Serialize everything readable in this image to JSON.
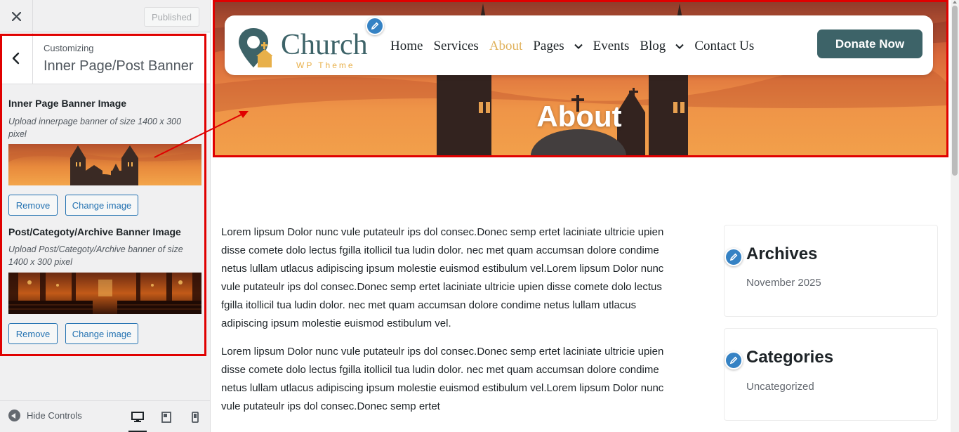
{
  "header": {
    "close_icon": "close-icon",
    "published_label": "Published"
  },
  "section": {
    "customizing_label": "Customizing",
    "title": "Inner Page/Post Banner"
  },
  "controls": [
    {
      "label": "Inner Page Banner Image",
      "description": "Upload innerpage banner of size 1400 x 300 pixel",
      "remove_label": "Remove",
      "change_label": "Change image"
    },
    {
      "label": "Post/Categoty/Archive Banner Image",
      "description": "Upload Post/Categoty/Archive banner of size 1400 x 300 pixel",
      "remove_label": "Remove",
      "change_label": "Change image"
    }
  ],
  "footer": {
    "hide_controls_label": "Hide Controls",
    "devices": [
      "desktop-icon",
      "tablet-icon",
      "mobile-icon"
    ]
  },
  "site": {
    "logo_text": "Church",
    "logo_subtext": "WP Theme",
    "menu": [
      {
        "label": "Home",
        "active": false,
        "dropdown": false
      },
      {
        "label": "Services",
        "active": false,
        "dropdown": false
      },
      {
        "label": "About",
        "active": true,
        "dropdown": false
      },
      {
        "label": "Pages",
        "active": false,
        "dropdown": true
      },
      {
        "label": "Events",
        "active": false,
        "dropdown": false
      },
      {
        "label": "Blog",
        "active": false,
        "dropdown": true
      },
      {
        "label": "Contact Us",
        "active": false,
        "dropdown": false
      }
    ],
    "donate_label": "Donate Now",
    "hero_title": "About",
    "paragraphs": [
      "Lorem lipsum Dolor nunc vule putateulr ips dol consec.Donec semp ertet laciniate ultricie upien disse comete dolo lectus fgilla itollicil tua ludin dolor. nec met quam accumsan dolore condime netus lullam utlacus adipiscing ipsum molestie euismod estibulum vel.Lorem lipsum Dolor nunc vule putateulr ips dol consec.Donec semp ertet laciniate ultricie upien disse comete dolo lectus fgilla itollicil tua ludin dolor. nec met quam accumsan dolore condime netus lullam utlacus adipiscing ipsum molestie euismod estibulum vel.",
      "Lorem lipsum Dolor nunc vule putateulr ips dol consec.Donec semp ertet laciniate ultricie upien disse comete dolo lectus fgilla itollicil tua ludin dolor. nec met quam accumsan dolore condime netus lullam utlacus adipiscing ipsum molestie euismod estibulum vel.Lorem lipsum Dolor nunc vule putateulr ips dol consec.Donec semp ertet"
    ],
    "widgets": [
      {
        "title": "Archives",
        "item": "November 2025"
      },
      {
        "title": "Categories",
        "item": "Uncategorized"
      }
    ]
  },
  "colors": {
    "accent": "#2271b1",
    "brand": "#3d6368",
    "highlight": "#e00000",
    "active_menu": "#e0b25c"
  }
}
